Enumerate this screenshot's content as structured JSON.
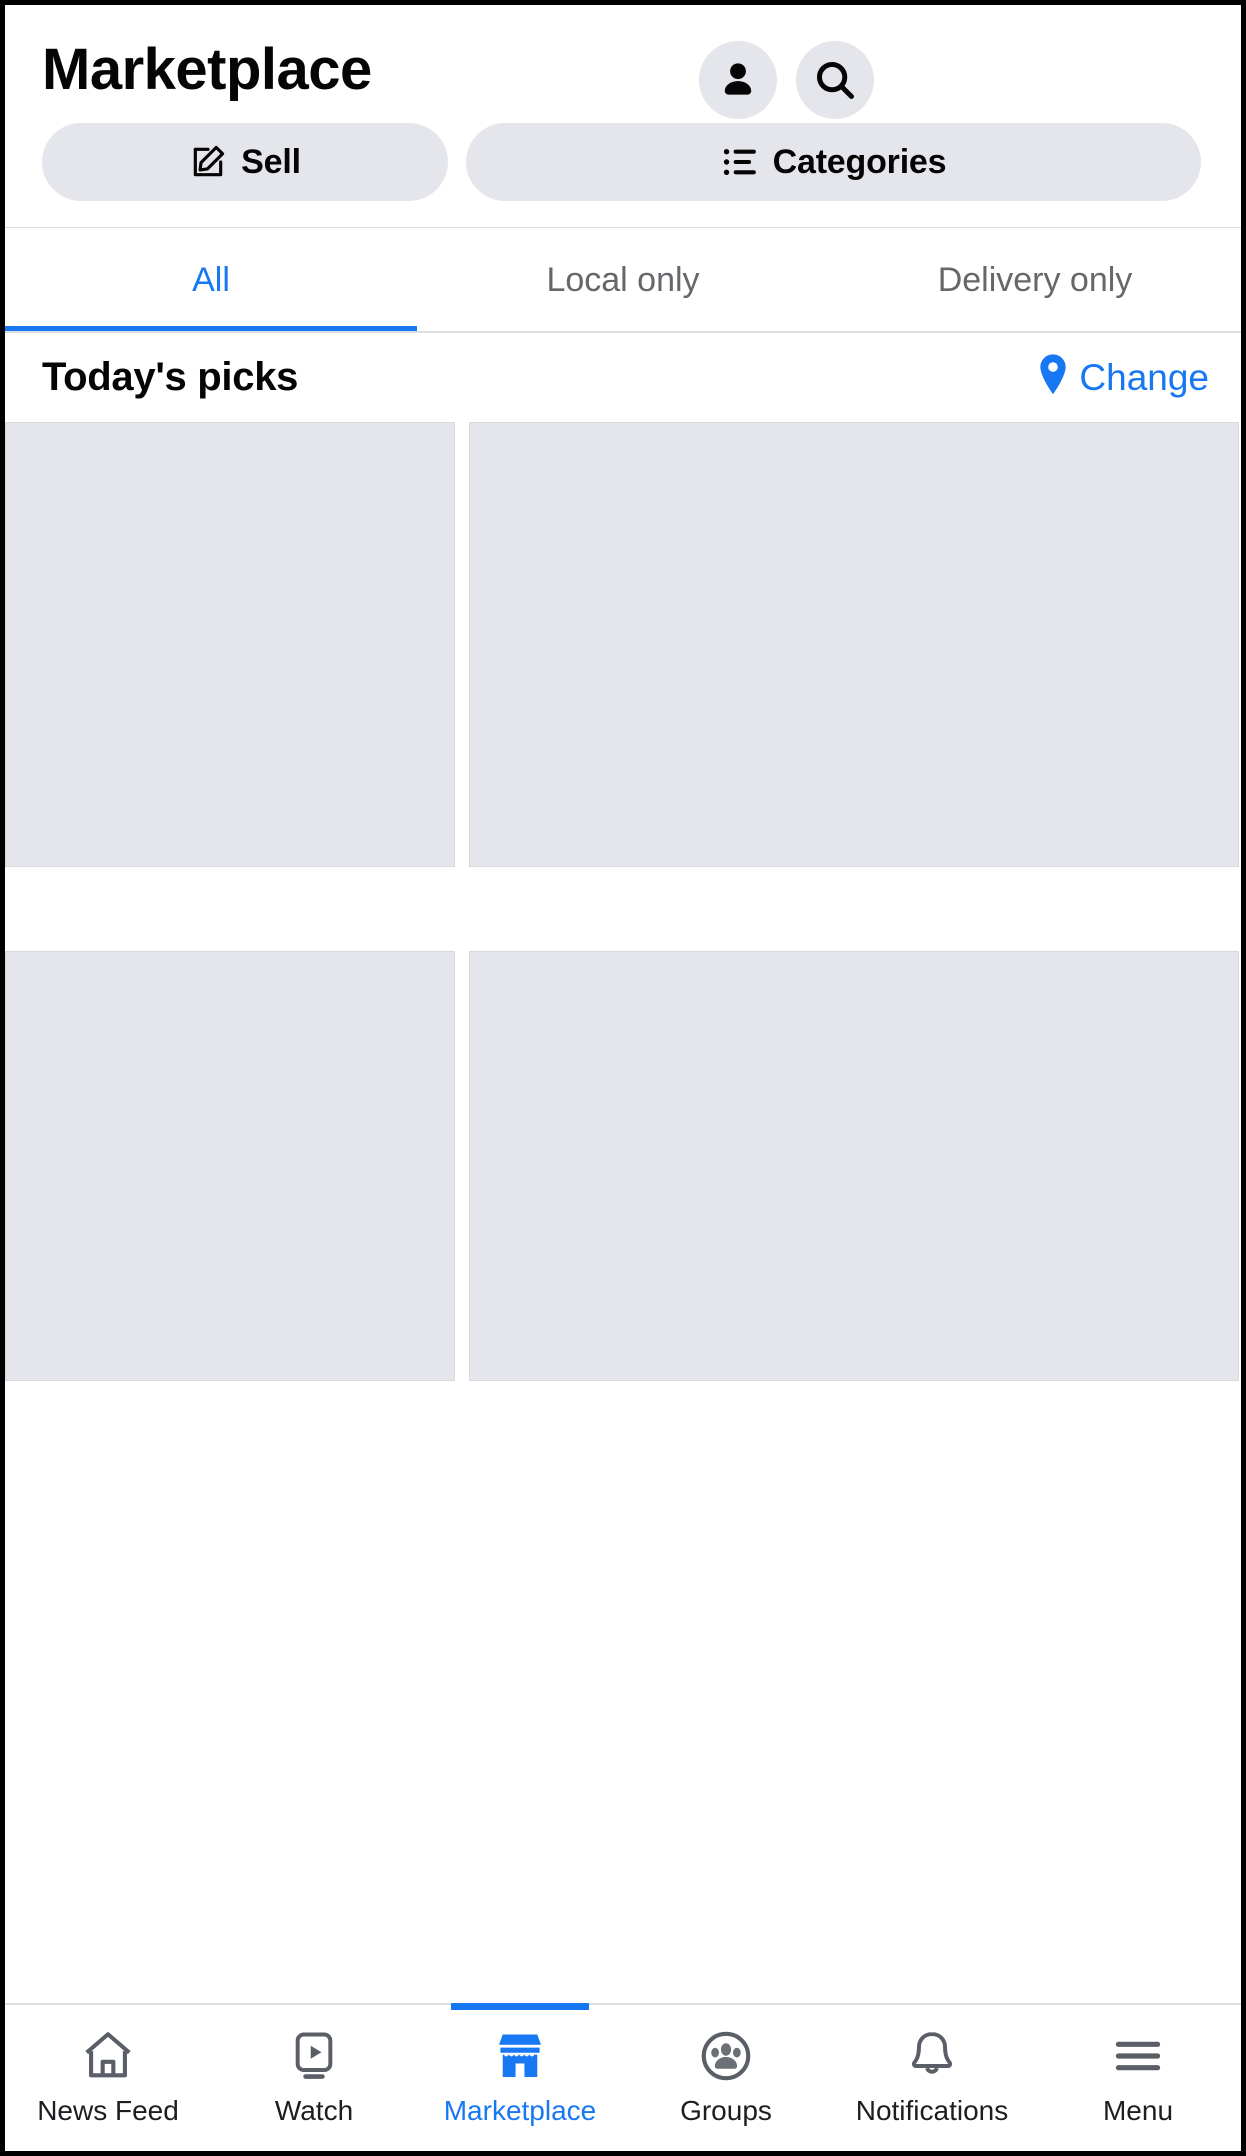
{
  "header": {
    "title": "Marketplace",
    "profile_icon": "person-icon",
    "search_icon": "search-icon",
    "buttons": [
      {
        "label": "Sell",
        "icon": "compose-pencil-icon"
      },
      {
        "label": "Categories",
        "icon": "list-icon"
      }
    ]
  },
  "filter_tabs": [
    {
      "label": "All",
      "active": true
    },
    {
      "label": "Local only",
      "active": false
    },
    {
      "label": "Delivery only",
      "active": false
    }
  ],
  "section": {
    "title": "Today's picks",
    "change_label": "Change",
    "change_icon": "location-pin-icon"
  },
  "listings": {
    "placeholder_count": 4,
    "columns": 2
  },
  "bottom_nav": [
    {
      "label": "News Feed",
      "icon": "home-icon",
      "active": false
    },
    {
      "label": "Watch",
      "icon": "video-play-icon",
      "active": false
    },
    {
      "label": "Marketplace",
      "icon": "storefront-icon",
      "active": true
    },
    {
      "label": "Groups",
      "icon": "groups-icon",
      "active": false
    },
    {
      "label": "Notifications",
      "icon": "bell-icon",
      "active": false
    },
    {
      "label": "Menu",
      "icon": "hamburger-menu-icon",
      "active": false
    }
  ],
  "colors": {
    "accent": "#1877f2",
    "chip_bg": "#e4e6eb",
    "text_primary": "#050505",
    "text_secondary": "#65676b",
    "divider": "#dadde1",
    "placeholder": "#e4e6eb"
  }
}
